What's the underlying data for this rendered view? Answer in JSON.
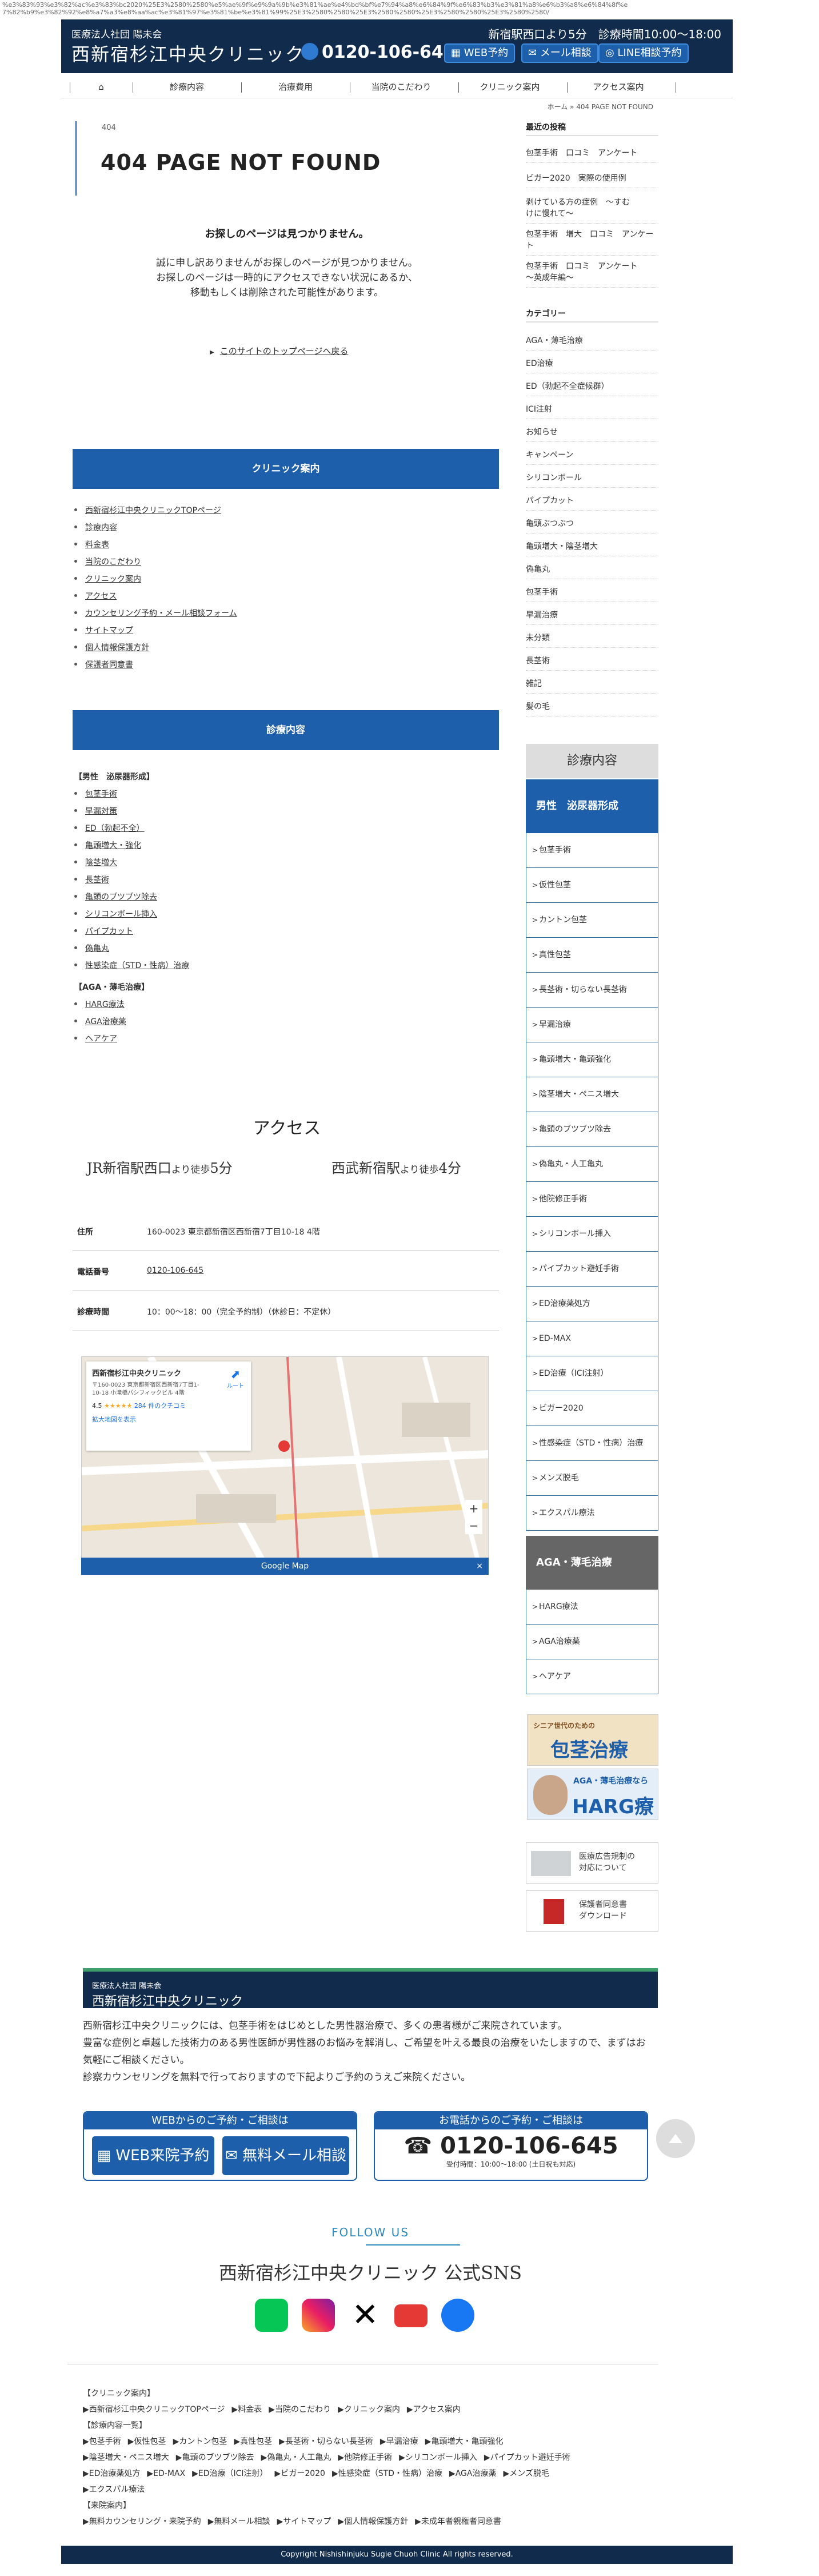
{
  "url_overflow": "%e3%83%93%e3%82%ac%e3%83%bc2020%25E3%2580%2580%e5%ae%9f%e9%9a%9b%e3%81%ae%e4%bd%bf%e7%94%a8%e6%84%9f%e6%83%b3%e3%81%a8%e6%b3%a8%e6%84%8f%e7%82%b9%e3%82%92%e8%a7%a3%e8%aa%ac%e3%81%97%e3%81%be%e3%81%99%25E3%2580%2580%25E3%2580%2580%25E3%2580%2580%25E3%2580%2580/",
  "header": {
    "corp": "医療法人社団 陽未会",
    "clinic": "西新宿杉江中央クリニック",
    "hours": "新宿駅西口より5分　診療時間10:00～18:00",
    "tel": "0120-106-645",
    "btn_web": "WEB予約",
    "btn_mail": "メール相談",
    "btn_line": "LINE相談予約"
  },
  "nav": {
    "home": "⌂",
    "items": [
      "診療内容",
      "治療費用",
      "当院のこだわり",
      "クリニック案内",
      "アクセス案内"
    ]
  },
  "breadcrumb": "ホーム » 404 PAGE NOT FOUND",
  "main": {
    "tag": "404",
    "title": "404 PAGE NOT FOUND",
    "lost": "お探しのページは見つかりません。",
    "sorry": [
      "誠に申し訳ありませんがお探しのページが見つかりません。",
      "お探しのページは一時的にアクセスできない状況にあるか、",
      "移動もしくは削除された可能性があります。"
    ],
    "toplink": "このサイトのトップページへ戻る"
  },
  "clinic_band": "クリニック案内",
  "clinic_links": [
    "西新宿杉江中央クリニックTOPページ",
    "診療内容",
    "料金表",
    "当院のこだわり",
    "クリニック案内",
    "アクセス",
    "カウンセリング予約・メール相談フォーム",
    "サイトマップ",
    "個人情報保護方針",
    "保護者同意書"
  ],
  "treat_band": "診療内容",
  "treat_group1_title": "【男性　泌尿器形成】",
  "treat_group1": [
    "包茎手術",
    "早漏対策",
    "ED（勃起不全）",
    "亀頭増大・強化",
    "陰茎増大",
    "長茎術",
    "亀頭のブツブツ除去",
    "シリコンボール挿入",
    "パイプカット",
    "偽亀丸",
    "性感染症（STD・性病）治療"
  ],
  "treat_group2_title": "【AGA・薄毛治療】",
  "treat_group2": [
    "HARG療法",
    "AGA治療薬",
    "ヘアケア"
  ],
  "access": {
    "title": "アクセス",
    "walk1a": "JR新宿駅西口",
    "walk1b": "より徒歩",
    "walk1c": "5分",
    "walk2a": "西武新宿駅",
    "walk2b": "より徒歩",
    "walk2c": "4分",
    "address_k": "住所",
    "address_v": "160-0023 東京都新宿区西新宿7丁目10-18 4階",
    "tel_k": "電話番号",
    "tel_v": "0120-106-645",
    "hours_k": "診療時間",
    "hours_v": "10：00～18：00（完全予約制）（休診日：不定休）"
  },
  "map": {
    "name": "西新宿杉江中央クリニック",
    "addr": "〒160-0023 東京都新宿区西新宿7丁目1-10-18 小滝橋パシフィックビル 4階",
    "rating": "4.5",
    "reviews": "284 件のクチコミ",
    "bigger": "拡大地図を表示",
    "route": "ルート",
    "bar": "Google Map",
    "close": "×"
  },
  "sidebar": {
    "recent_title": "最近の投稿",
    "recent": [
      "包茎手術　口コミ　アンケート",
      "ビガー2020　実際の使用例",
      "剥けている方の症例　〜すむ\nけに慢れて〜",
      "包茎手術　増大　口コミ　アンケート",
      "包茎手術　口コミ　アンケート\n〜英成年編〜"
    ],
    "cat_title": "カテゴリー",
    "cats": [
      "AGA・薄毛治療",
      "ED治療",
      "ED（勃起不全症候群）",
      "ICI注射",
      "お知らせ",
      "キャンペーン",
      "シリコンボール",
      "パイプカット",
      "亀頭ぶつぶつ",
      "亀頭増大・陰茎増大",
      "偽亀丸",
      "包茎手術",
      "早漏治療",
      "未分類",
      "長茎術",
      "雑記",
      "髪の毛"
    ],
    "sv_head": "診療内容",
    "sv_male": "男性　泌尿器形成",
    "sv_items": [
      "包茎手術",
      "仮性包茎",
      "カントン包茎",
      "真性包茎",
      "長茎術・切らない長茎術",
      "早漏治療",
      "亀頭増大・亀頭強化",
      "陰茎増大・ペニス増大",
      "亀頭のブツブツ除去",
      "偽亀丸・人工亀丸",
      "他院修正手術",
      "シリコンボール挿入",
      "パイプカット避妊手術",
      "ED治療薬処方",
      "ED-MAX",
      "ED治療（ICI注射）",
      "ビガー2020",
      "性感染症（STD・性病）治療",
      "メンズ脱毛",
      "エクスパル療法"
    ],
    "sv_aga": "AGA・薄毛治療",
    "sv_aga_items": [
      "HARG療法",
      "AGA治療薬",
      "ヘアケア"
    ],
    "banner1a": "シニア世代のための",
    "banner1b": "包茎治療",
    "banner2a": "AGA・薄毛治療なら",
    "banner2b": "HARG療法",
    "btn_ad": "医療広告規制の\n対応について",
    "btn_consent": "保護者同意書\nダウンロード"
  },
  "footer": {
    "corp": "医療法人社団 陽未会",
    "clinic": "西新宿杉江中央クリニック",
    "desc": [
      "西新宿杉江中央クリニックには、包茎手術をはじめとした男性器治療で、多くの患者様がご来院されています。",
      "豊富な症例と卓越した技術力のある男性医師が男性器のお悩みを解消し、ご希望を叶える最良の治療をいたしますので、まずはお",
      "気軽にご相談ください。",
      "診察カウンセリングを無料で行っておりますので下記よりご予約のうえご来院ください。"
    ],
    "web_hd": "WEBからのご予約・ご相談は",
    "web_btn1": "WEB来院予約",
    "web_btn2": "無料メール相談",
    "tel_hd": "お電話からのご予約・ご相談は",
    "tel_num": "0120-106-645",
    "tel_sub": "受付時間：10:00～18:00 (土日祝も対応)",
    "sns_hd": "FOLLOW US",
    "sns_title": "西新宿杉江中央クリニック 公式SNS",
    "links": [
      [
        "【クリニック案内】"
      ],
      [
        "▶西新宿杉江中央クリニックTOPページ",
        "▶料金表",
        "▶当院のこだわり",
        "▶クリニック案内",
        "▶アクセス案内"
      ],
      [
        "【診療内容一覧】"
      ],
      [
        "▶包茎手術",
        "▶仮性包茎",
        "▶カントン包茎",
        "▶真性包茎",
        "▶長茎術・切らない長茎術",
        "▶早漏治療",
        "▶亀頭増大・亀頭強化"
      ],
      [
        "▶陰茎増大・ペニス増大",
        "▶亀頭のブツブツ除去",
        "▶偽亀丸・人工亀丸",
        "▶他院修正手術",
        "▶シリコンボール挿入",
        "▶パイプカット避妊手術"
      ],
      [
        "▶ED治療薬処方",
        "▶ED-MAX",
        "▶ED治療（ICI注射）",
        "▶ビガー2020",
        "▶性感染症（STD・性病）治療",
        "▶AGA治療薬",
        "▶メンズ脱毛"
      ],
      [
        "▶エクスパル療法"
      ],
      [
        "【来院案内】"
      ],
      [
        "▶無料カウンセリング・来院予約",
        "▶無料メール相談",
        "▶サイトマップ",
        "▶個人情報保護方針",
        "▶未成年者親権者同意書"
      ]
    ],
    "copyright": "Copyright Nishishinjuku Sugie Chuoh Clinic All rights reserved."
  }
}
